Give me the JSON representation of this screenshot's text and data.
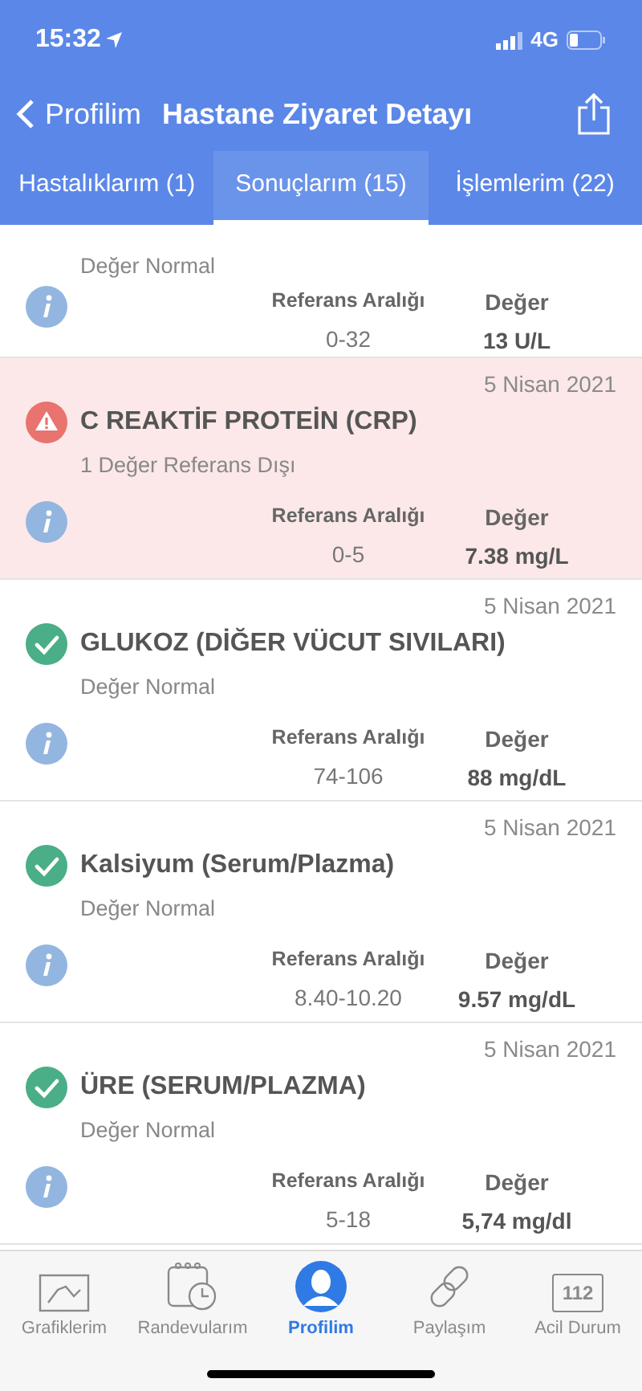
{
  "status_bar": {
    "time": "15:32",
    "network": "4G"
  },
  "nav": {
    "back_label": "Profilim",
    "title": "Hastane Ziyaret Detayı"
  },
  "tabs": [
    {
      "label": "Hastalıklarım (1)",
      "selected": false
    },
    {
      "label": "Sonuçlarım (15)",
      "selected": true
    },
    {
      "label": "İşlemlerim (22)",
      "selected": false
    }
  ],
  "results": [
    {
      "kind": "partial",
      "flagged": false,
      "subtitle": "Değer Normal",
      "ref_header": "Referans Aralığı",
      "value_header": "Değer",
      "ref": "0-32",
      "value": "13 U/L"
    },
    {
      "kind": "warning",
      "flagged": true,
      "date": "5 Nisan 2021",
      "title": "C REAKTİF PROTEİN (CRP)",
      "subtitle": "1 Değer Referans Dışı",
      "ref_header": "Referans Aralığı",
      "value_header": "Değer",
      "ref": "0-5",
      "value": "7.38 mg/L"
    },
    {
      "kind": "ok",
      "flagged": false,
      "date": "5 Nisan 2021",
      "title": "GLUKOZ (DİĞER VÜCUT SIVILARI)",
      "subtitle": "Değer Normal",
      "ref_header": "Referans Aralığı",
      "value_header": "Değer",
      "ref": "74-106",
      "value": "88 mg/dL"
    },
    {
      "kind": "ok",
      "flagged": false,
      "date": "5 Nisan 2021",
      "title": "Kalsiyum (Serum/Plazma)",
      "subtitle": "Değer Normal",
      "ref_header": "Referans Aralığı",
      "value_header": "Değer",
      "ref": "8.40-10.20",
      "value": "9.57 mg/dL"
    },
    {
      "kind": "ok",
      "flagged": false,
      "date": "5 Nisan 2021",
      "title": "ÜRE (SERUM/PLAZMA)",
      "subtitle": "Değer Normal",
      "ref_header": "Referans Aralığı",
      "value_header": "Değer",
      "ref": "5-18",
      "value": "5,74 mg/dl"
    }
  ],
  "tab_bar": [
    {
      "kind": "chart",
      "label": "Grafiklerim",
      "selected": false
    },
    {
      "kind": "calendar",
      "label": "Randevularım",
      "selected": false
    },
    {
      "kind": "profile",
      "label": "Profilim",
      "selected": true
    },
    {
      "kind": "link",
      "label": "Paylaşım",
      "selected": false
    },
    {
      "kind": "emergency",
      "label": "Acil Durum",
      "icon_text": "112",
      "selected": false
    }
  ]
}
